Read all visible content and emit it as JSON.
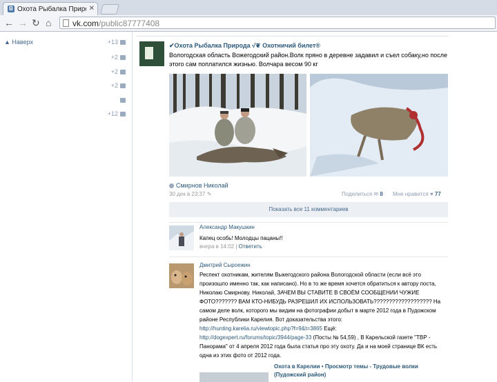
{
  "browser": {
    "tab_title": "Охота Рыбалка Природ",
    "tab_favicon": "В",
    "url_host": "vk.com",
    "url_path": "/public87777408"
  },
  "sidebar": {
    "back_label": "Наверх",
    "counters": [
      {
        "value": "+13",
        "icon": "user-icon"
      },
      {
        "value": "+2",
        "icon": "camera-icon"
      },
      {
        "value": "+2",
        "icon": "mail-icon"
      },
      {
        "value": "+2",
        "icon": "group-icon"
      },
      {
        "value": "",
        "icon": "comment-icon"
      },
      {
        "value": "+12",
        "icon": "gear-icon"
      }
    ]
  },
  "post": {
    "group_name": "✔Охота Рыбалка Природа √❦ Охотничий билет®",
    "text": "Вологодская область Вожегодский район.Волк пряно в деревне задавил и съел собаку,но после этого сам поплатился жизнью. Волчара весом 90 кг",
    "author": "Смирнов Николай",
    "date": "30 дек в 23:37",
    "share_label": "Поделиться",
    "share_count": "8",
    "like_label": "Мне нравится",
    "like_count": "77",
    "show_all_comments": "Показать все 11 комментариев"
  },
  "comments": [
    {
      "name": "Александр Макушкин",
      "text": "Капец особь! Молодцы пацаны!!",
      "time": "вчера в 14:02",
      "reply": "Ответить"
    },
    {
      "name": "Дмитрий Сыроежин",
      "text_part1": "Респект охотникам, жителям Выкегодского района Вологодской области (если всё это произошло именно так, как написано). Но в то же время хочется обратиться к автору поста, Николаю Смирнову. Николай, ЗАЧЕМ ВЫ СТАВИТЕ В СВОЁМ СООБЩЕНИИ ЧУЖИЕ ФОТО??????? ВАМ КТО-НИБУДЬ РАЗРЕШИЛ ИХ ИСПОЛЬЗОВАТЬ??????????????????? На самом деле волк, которого мы видим на фотографии добыт в марте 2012 года в Пудожском районе Республики Карелия. Вот доказательства этого:",
      "link1": "http://hunting.karelia.ru/viewtopic.php?f=9&t=3865",
      "text_part2": " Ещё:",
      "link2": "http://dogexpert.ru/forums/topic/3944/page-33",
      "text_part3": " (Посты № 54,59) , В Карельской газете \"ТВР - Панорама\" от 4 апреля 2012 года была статья про эту охоту.  Да и на моей странице ВК есть одна из этих фото от 2012 года.",
      "link_preview": "Охота в Карелии • Просмотр темы - Трудовые волки (Пудожский район)"
    }
  ]
}
